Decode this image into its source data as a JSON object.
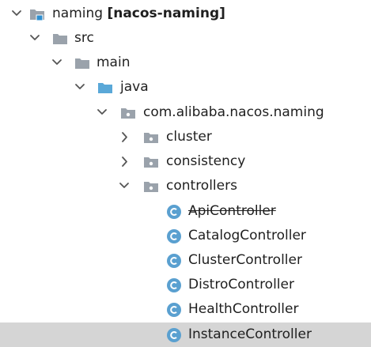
{
  "project_tree": {
    "root": {
      "label": "naming",
      "module": "[nacos-naming]",
      "icon": "module-folder-icon",
      "expanded": true
    },
    "src": {
      "label": "src",
      "icon": "folder-icon",
      "expanded": true
    },
    "main": {
      "label": "main",
      "icon": "folder-icon",
      "expanded": true
    },
    "java": {
      "label": "java",
      "icon": "source-root-folder-icon",
      "expanded": true
    },
    "package": {
      "label": "com.alibaba.nacos.naming",
      "icon": "package-icon",
      "expanded": true
    },
    "packages": [
      {
        "label": "cluster",
        "icon": "package-icon",
        "expanded": false
      },
      {
        "label": "consistency",
        "icon": "package-icon",
        "expanded": false
      },
      {
        "label": "controllers",
        "icon": "package-icon",
        "expanded": true
      }
    ],
    "classes": [
      {
        "label": "ApiController",
        "icon": "class-icon",
        "deprecated": true
      },
      {
        "label": "CatalogController",
        "icon": "class-icon",
        "deprecated": false
      },
      {
        "label": "ClusterController",
        "icon": "class-icon",
        "deprecated": false
      },
      {
        "label": "DistroController",
        "icon": "class-icon",
        "deprecated": false
      },
      {
        "label": "HealthController",
        "icon": "class-icon",
        "deprecated": false
      },
      {
        "label": "InstanceController",
        "icon": "class-icon",
        "deprecated": false,
        "selected": true
      }
    ],
    "colors": {
      "selection": "#d5d5d5",
      "folder": "#9aa2ab",
      "source_folder": "#5aa8d8",
      "class_circle": "#5aa0d0",
      "text": "#1f1f1f"
    }
  }
}
